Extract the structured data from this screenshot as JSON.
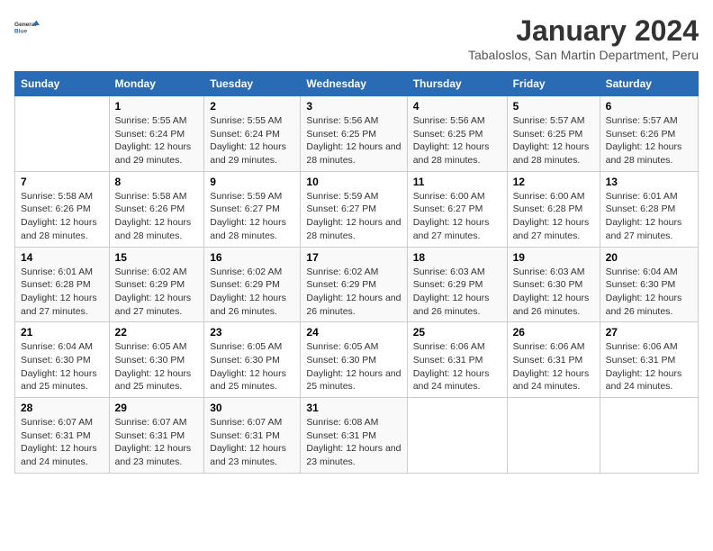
{
  "logo": {
    "line1": "General",
    "line2": "Blue"
  },
  "title": "January 2024",
  "subtitle": "Tabaloslos, San Martin Department, Peru",
  "days_of_week": [
    "Sunday",
    "Monday",
    "Tuesday",
    "Wednesday",
    "Thursday",
    "Friday",
    "Saturday"
  ],
  "weeks": [
    [
      {
        "num": "",
        "sunrise": "",
        "sunset": "",
        "daylight": ""
      },
      {
        "num": "1",
        "sunrise": "Sunrise: 5:55 AM",
        "sunset": "Sunset: 6:24 PM",
        "daylight": "Daylight: 12 hours and 29 minutes."
      },
      {
        "num": "2",
        "sunrise": "Sunrise: 5:55 AM",
        "sunset": "Sunset: 6:24 PM",
        "daylight": "Daylight: 12 hours and 29 minutes."
      },
      {
        "num": "3",
        "sunrise": "Sunrise: 5:56 AM",
        "sunset": "Sunset: 6:25 PM",
        "daylight": "Daylight: 12 hours and 28 minutes."
      },
      {
        "num": "4",
        "sunrise": "Sunrise: 5:56 AM",
        "sunset": "Sunset: 6:25 PM",
        "daylight": "Daylight: 12 hours and 28 minutes."
      },
      {
        "num": "5",
        "sunrise": "Sunrise: 5:57 AM",
        "sunset": "Sunset: 6:25 PM",
        "daylight": "Daylight: 12 hours and 28 minutes."
      },
      {
        "num": "6",
        "sunrise": "Sunrise: 5:57 AM",
        "sunset": "Sunset: 6:26 PM",
        "daylight": "Daylight: 12 hours and 28 minutes."
      }
    ],
    [
      {
        "num": "7",
        "sunrise": "Sunrise: 5:58 AM",
        "sunset": "Sunset: 6:26 PM",
        "daylight": "Daylight: 12 hours and 28 minutes."
      },
      {
        "num": "8",
        "sunrise": "Sunrise: 5:58 AM",
        "sunset": "Sunset: 6:26 PM",
        "daylight": "Daylight: 12 hours and 28 minutes."
      },
      {
        "num": "9",
        "sunrise": "Sunrise: 5:59 AM",
        "sunset": "Sunset: 6:27 PM",
        "daylight": "Daylight: 12 hours and 28 minutes."
      },
      {
        "num": "10",
        "sunrise": "Sunrise: 5:59 AM",
        "sunset": "Sunset: 6:27 PM",
        "daylight": "Daylight: 12 hours and 28 minutes."
      },
      {
        "num": "11",
        "sunrise": "Sunrise: 6:00 AM",
        "sunset": "Sunset: 6:27 PM",
        "daylight": "Daylight: 12 hours and 27 minutes."
      },
      {
        "num": "12",
        "sunrise": "Sunrise: 6:00 AM",
        "sunset": "Sunset: 6:28 PM",
        "daylight": "Daylight: 12 hours and 27 minutes."
      },
      {
        "num": "13",
        "sunrise": "Sunrise: 6:01 AM",
        "sunset": "Sunset: 6:28 PM",
        "daylight": "Daylight: 12 hours and 27 minutes."
      }
    ],
    [
      {
        "num": "14",
        "sunrise": "Sunrise: 6:01 AM",
        "sunset": "Sunset: 6:28 PM",
        "daylight": "Daylight: 12 hours and 27 minutes."
      },
      {
        "num": "15",
        "sunrise": "Sunrise: 6:02 AM",
        "sunset": "Sunset: 6:29 PM",
        "daylight": "Daylight: 12 hours and 27 minutes."
      },
      {
        "num": "16",
        "sunrise": "Sunrise: 6:02 AM",
        "sunset": "Sunset: 6:29 PM",
        "daylight": "Daylight: 12 hours and 26 minutes."
      },
      {
        "num": "17",
        "sunrise": "Sunrise: 6:02 AM",
        "sunset": "Sunset: 6:29 PM",
        "daylight": "Daylight: 12 hours and 26 minutes."
      },
      {
        "num": "18",
        "sunrise": "Sunrise: 6:03 AM",
        "sunset": "Sunset: 6:29 PM",
        "daylight": "Daylight: 12 hours and 26 minutes."
      },
      {
        "num": "19",
        "sunrise": "Sunrise: 6:03 AM",
        "sunset": "Sunset: 6:30 PM",
        "daylight": "Daylight: 12 hours and 26 minutes."
      },
      {
        "num": "20",
        "sunrise": "Sunrise: 6:04 AM",
        "sunset": "Sunset: 6:30 PM",
        "daylight": "Daylight: 12 hours and 26 minutes."
      }
    ],
    [
      {
        "num": "21",
        "sunrise": "Sunrise: 6:04 AM",
        "sunset": "Sunset: 6:30 PM",
        "daylight": "Daylight: 12 hours and 25 minutes."
      },
      {
        "num": "22",
        "sunrise": "Sunrise: 6:05 AM",
        "sunset": "Sunset: 6:30 PM",
        "daylight": "Daylight: 12 hours and 25 minutes."
      },
      {
        "num": "23",
        "sunrise": "Sunrise: 6:05 AM",
        "sunset": "Sunset: 6:30 PM",
        "daylight": "Daylight: 12 hours and 25 minutes."
      },
      {
        "num": "24",
        "sunrise": "Sunrise: 6:05 AM",
        "sunset": "Sunset: 6:30 PM",
        "daylight": "Daylight: 12 hours and 25 minutes."
      },
      {
        "num": "25",
        "sunrise": "Sunrise: 6:06 AM",
        "sunset": "Sunset: 6:31 PM",
        "daylight": "Daylight: 12 hours and 24 minutes."
      },
      {
        "num": "26",
        "sunrise": "Sunrise: 6:06 AM",
        "sunset": "Sunset: 6:31 PM",
        "daylight": "Daylight: 12 hours and 24 minutes."
      },
      {
        "num": "27",
        "sunrise": "Sunrise: 6:06 AM",
        "sunset": "Sunset: 6:31 PM",
        "daylight": "Daylight: 12 hours and 24 minutes."
      }
    ],
    [
      {
        "num": "28",
        "sunrise": "Sunrise: 6:07 AM",
        "sunset": "Sunset: 6:31 PM",
        "daylight": "Daylight: 12 hours and 24 minutes."
      },
      {
        "num": "29",
        "sunrise": "Sunrise: 6:07 AM",
        "sunset": "Sunset: 6:31 PM",
        "daylight": "Daylight: 12 hours and 23 minutes."
      },
      {
        "num": "30",
        "sunrise": "Sunrise: 6:07 AM",
        "sunset": "Sunset: 6:31 PM",
        "daylight": "Daylight: 12 hours and 23 minutes."
      },
      {
        "num": "31",
        "sunrise": "Sunrise: 6:08 AM",
        "sunset": "Sunset: 6:31 PM",
        "daylight": "Daylight: 12 hours and 23 minutes."
      },
      {
        "num": "",
        "sunrise": "",
        "sunset": "",
        "daylight": ""
      },
      {
        "num": "",
        "sunrise": "",
        "sunset": "",
        "daylight": ""
      },
      {
        "num": "",
        "sunrise": "",
        "sunset": "",
        "daylight": ""
      }
    ]
  ]
}
